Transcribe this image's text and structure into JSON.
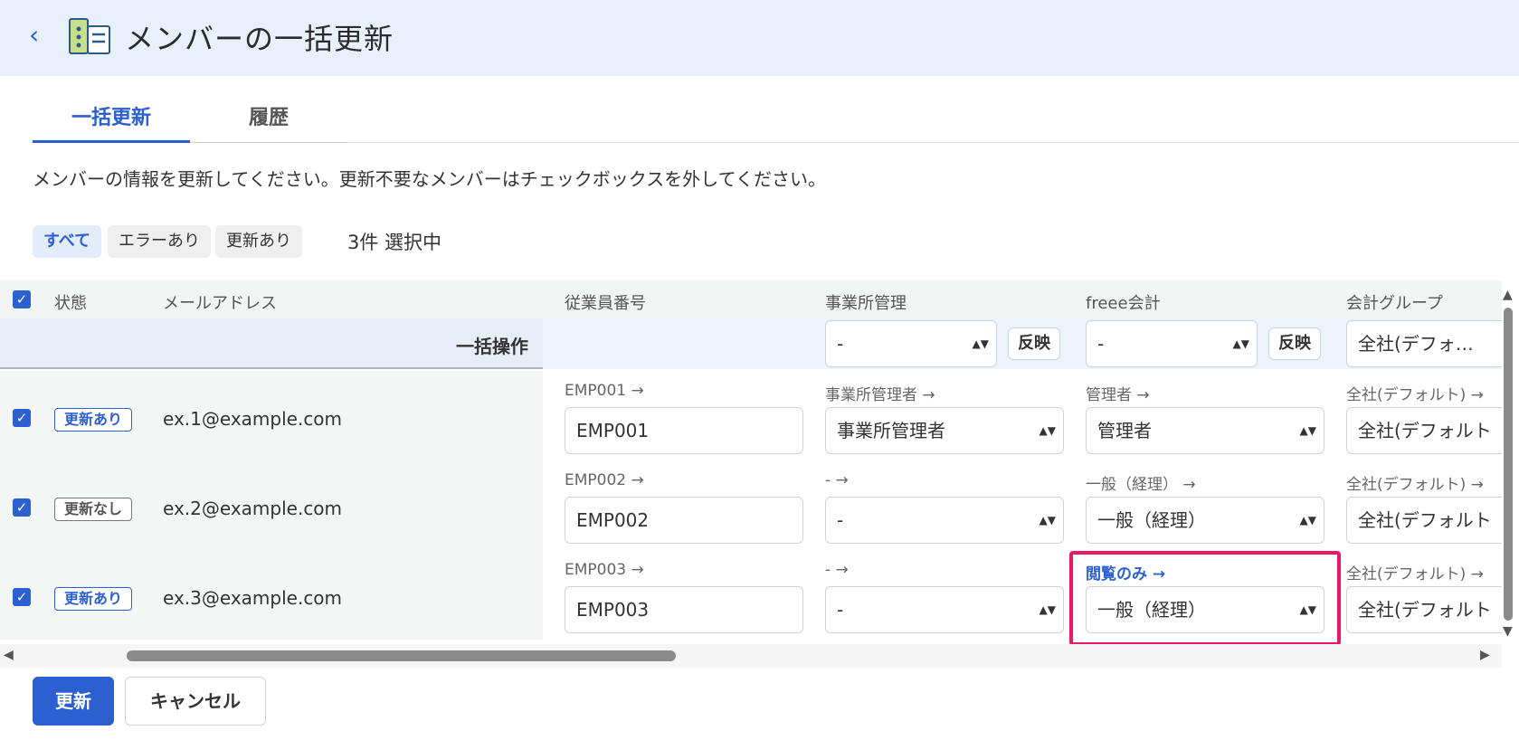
{
  "header": {
    "back_glyph": "‹",
    "title": "メンバーの一括更新"
  },
  "tabs": [
    {
      "label": "一括更新"
    },
    {
      "label": "履歴"
    }
  ],
  "description": "メンバーの情報を更新してください。更新不要なメンバーはチェックボックスを外してください。",
  "filters": [
    {
      "label": "すべて"
    },
    {
      "label": "エラーあり"
    },
    {
      "label": "更新あり"
    }
  ],
  "selection_count": "3件 選択中",
  "table": {
    "headers": {
      "status": "状態",
      "email": "メールアドレス",
      "employee_no": "従業員番号",
      "office_admin": "事業所管理",
      "freee": "freee会計",
      "group": "会計グループ"
    },
    "bulk": {
      "label": "一括操作",
      "office_value": "-",
      "freee_value": "-",
      "group_value": "全社(デフォ…",
      "reflect_label": "反映"
    },
    "rows": [
      {
        "status": "更新あり",
        "email": "ex.1@example.com",
        "emp_prev": "EMP001 →",
        "emp_value": "EMP001",
        "office_prev": "事業所管理者 →",
        "office_value": "事業所管理者",
        "freee_prev": "管理者 →",
        "freee_value": "管理者",
        "group_prev": "全社(デフォルト) →",
        "group_value": "全社(デフォルト"
      },
      {
        "status": "更新なし",
        "email": "ex.2@example.com",
        "emp_prev": "EMP002 →",
        "emp_value": "EMP002",
        "office_prev": "- →",
        "office_value": "-",
        "freee_prev": "一般（経理） →",
        "freee_value": "一般（経理）",
        "group_prev": "全社(デフォルト) →",
        "group_value": "全社(デフォルト"
      },
      {
        "status": "更新あり",
        "email": "ex.3@example.com",
        "emp_prev": "EMP003 →",
        "emp_value": "EMP003",
        "office_prev": "- →",
        "office_value": "-",
        "freee_prev": "閲覧のみ →",
        "freee_value": "一般（経理）",
        "group_prev": "全社(デフォルト) →",
        "group_value": "全社(デフォルト"
      }
    ]
  },
  "buttons": {
    "update": "更新",
    "cancel": "キャンセル"
  },
  "glyphs": {
    "check": "✓",
    "select_arrow": "▲▼",
    "scroll_left": "◀",
    "scroll_right": "▶",
    "scroll_up": "▲",
    "scroll_down": "▼"
  },
  "colors": {
    "accent": "#2c5fd0",
    "header_bg": "#e8f0fc",
    "highlight": "#e8186b"
  }
}
